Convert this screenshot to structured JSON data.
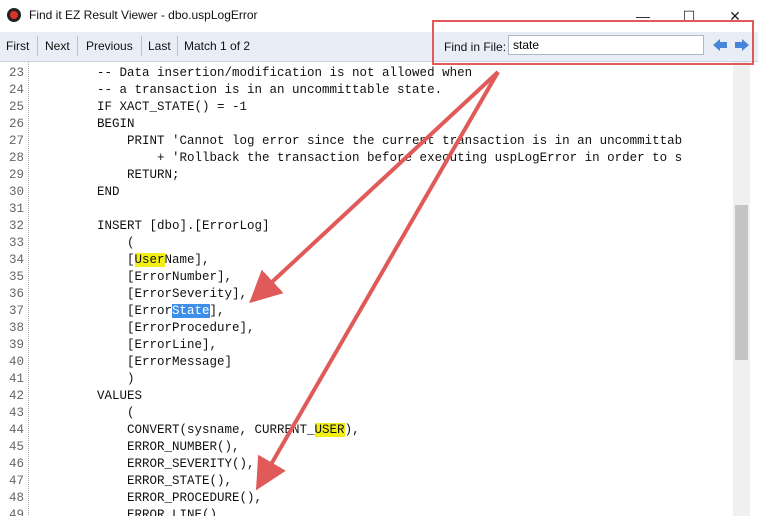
{
  "window": {
    "title": "Find it EZ Result Viewer - dbo.uspLogError",
    "minimize": "—",
    "maximize": "☐",
    "close": "✕"
  },
  "toolbar": {
    "first": "First",
    "next": "Next",
    "previous": "Previous",
    "last": "Last",
    "match": "Match 1 of 2",
    "find_label": "Find in File:",
    "find_value": "state"
  },
  "colors": {
    "accent_red": "#e05a5a",
    "match_yellow": "#f2ef17",
    "match_blue": "#3d8ee8"
  },
  "lines": [
    {
      "n": "23",
      "text": "        -- Data insertion/modification is not allowed when"
    },
    {
      "n": "24",
      "text": "        -- a transaction is in an uncommittable state."
    },
    {
      "n": "25",
      "text": "        IF XACT_STATE() = -1"
    },
    {
      "n": "26",
      "text": "        BEGIN"
    },
    {
      "n": "27",
      "text": "            PRINT 'Cannot log error since the current transaction is in an uncommittab"
    },
    {
      "n": "28",
      "text": "                + 'Rollback the transaction before executing uspLogError in order to s"
    },
    {
      "n": "29",
      "text": "            RETURN;"
    },
    {
      "n": "30",
      "text": "        END"
    },
    {
      "n": "31",
      "text": ""
    },
    {
      "n": "32",
      "text": "        INSERT [dbo].[ErrorLog]"
    },
    {
      "n": "33",
      "text": "            ("
    },
    {
      "n": "34",
      "pre": "            [",
      "hl": "User",
      "hl_type": "yellow",
      "post": "Name],"
    },
    {
      "n": "35",
      "text": "            [ErrorNumber],"
    },
    {
      "n": "36",
      "text": "            [ErrorSeverity],"
    },
    {
      "n": "37",
      "pre": "            [Error",
      "hl": "State",
      "hl_type": "blue",
      "post": "],"
    },
    {
      "n": "38",
      "text": "            [ErrorProcedure],"
    },
    {
      "n": "39",
      "text": "            [ErrorLine],"
    },
    {
      "n": "40",
      "text": "            [ErrorMessage]"
    },
    {
      "n": "41",
      "text": "            )"
    },
    {
      "n": "42",
      "text": "        VALUES"
    },
    {
      "n": "43",
      "text": "            ("
    },
    {
      "n": "44",
      "pre": "            CONVERT(sysname, CURRENT_",
      "hl": "USER",
      "hl_type": "yellow",
      "post": "),"
    },
    {
      "n": "45",
      "text": "            ERROR_NUMBER(),"
    },
    {
      "n": "46",
      "text": "            ERROR_SEVERITY(),"
    },
    {
      "n": "47",
      "text": "            ERROR_STATE(),"
    },
    {
      "n": "48",
      "text": "            ERROR_PROCEDURE(),"
    },
    {
      "n": "49",
      "text": "            ERROR_LINE(),"
    }
  ]
}
